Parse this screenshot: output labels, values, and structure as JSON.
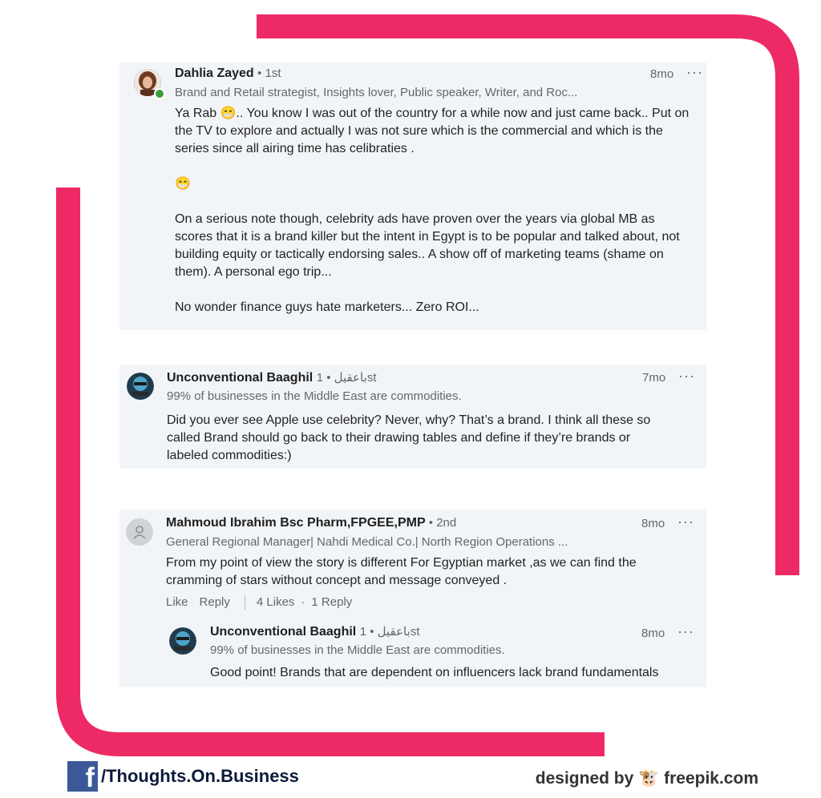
{
  "comments": [
    {
      "name": "Dahlia Zayed",
      "degree": "• 1st",
      "headline": "Brand and Retail strategist, Insights lover, Public speaker, Writer, and Roc...",
      "time": "8mo",
      "more": "···",
      "body": [
        "Ya Rab 😁.. You know I was out of the country for a while now and just came back.. Put on the TV to explore and  actually I was not sure which is the commercial and which is the series since all airing time has celibraties .",
        "😁",
        "On a serious note though, celebrity ads have proven over the years via global MB as scores that it is a brand killer but the intent in Egypt is to be popular and talked about, not building equity or tactically endorsing sales.. A show off of marketing teams (shame on them). A personal ego trip...",
        "No wonder finance guys hate marketers... Zero ROI..."
      ]
    },
    {
      "name": "Unconventional Baaghil",
      "degree": "باعقيل • 1st",
      "headline": "99% of businesses in the Middle East are commodities.",
      "time": "7mo",
      "more": "···",
      "body": [
        "Did you ever see Apple use celebrity? Never, why? That’s a brand. I think all these so called Brand should go back to their drawing tables and define if they’re brands or labeled commodities:)"
      ]
    },
    {
      "name": "Mahmoud Ibrahim Bsc Pharm,FPGEE,PMP",
      "degree": "• 2nd",
      "headline": "General Regional Manager| Nahdi Medical Co.| North Region Operations ...",
      "time": "8mo",
      "more": "···",
      "body": [
        "From my point of view the story is different For Egyptian market ,as we can find the cramming of stars without concept and message conveyed ."
      ],
      "actions": {
        "like": "Like",
        "reply": "Reply",
        "likes": "4 Likes",
        "dot": "·",
        "replies": "1 Reply"
      }
    },
    {
      "name": "Unconventional Baaghil",
      "degree": "باعقيل • 1st",
      "headline": "99% of businesses in the Middle East are commodities.",
      "time": "8mo",
      "more": "···",
      "body": [
        "Good point! Brands that are dependent on influencers lack brand fundamentals"
      ]
    }
  ],
  "footer": {
    "fb_letter": "f",
    "fb_handle": "/Thoughts.On.Business",
    "credit": "designed by 🐮 freepik.com"
  },
  "colors": {
    "frame": "#ee2a66",
    "card": "#f2f5f8",
    "facebook": "#3b5998"
  },
  "icons": {
    "more": "more-options-icon",
    "avatar_placeholder": "person-icon"
  }
}
